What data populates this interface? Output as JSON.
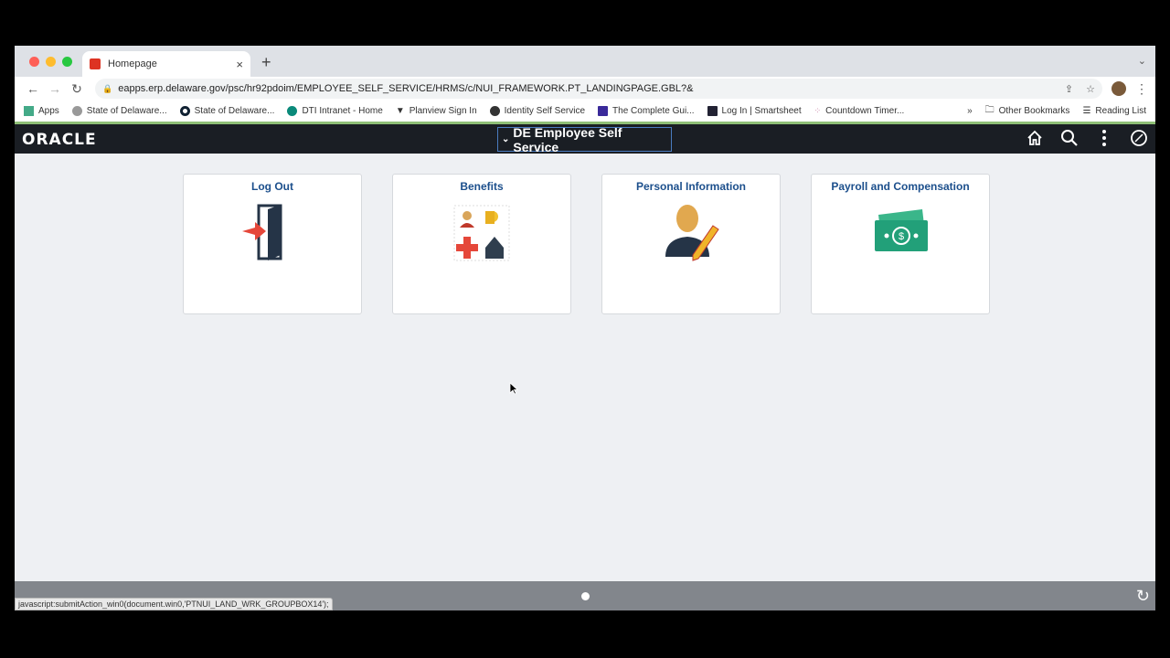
{
  "browser": {
    "tab_title": "Homepage",
    "url": "eapps.erp.delaware.gov/psc/hr92pdoim/EMPLOYEE_SELF_SERVICE/HRMS/c/NUI_FRAMEWORK.PT_LANDINGPAGE.GBL?&",
    "bookmarks": [
      "Apps",
      "State of Delaware...",
      "State of Delaware...",
      "DTI Intranet - Home",
      "Planview Sign In",
      "Identity Self Service",
      "The Complete Gui...",
      "Log In | Smartsheet",
      "Countdown Timer..."
    ],
    "other_bookmarks": "Other Bookmarks",
    "reading_list": "Reading List",
    "overflow": "»"
  },
  "header": {
    "logo": "ORACLE",
    "title": "DE Employee Self Service"
  },
  "tiles": [
    {
      "label": "Log Out",
      "icon": "logout-door-icon"
    },
    {
      "label": "Benefits",
      "icon": "benefits-icon"
    },
    {
      "label": "Personal Information",
      "icon": "person-edit-icon"
    },
    {
      "label": "Payroll and Compensation",
      "icon": "money-icon"
    }
  ],
  "status_bar": "javascript:submitAction_win0(document.win0,'PTNUI_LAND_WRK_GROUPBOX14');",
  "colors": {
    "header_bg": "#1a1e24",
    "tile_title": "#1c4f8c",
    "bottom_bar": "#82868c"
  }
}
